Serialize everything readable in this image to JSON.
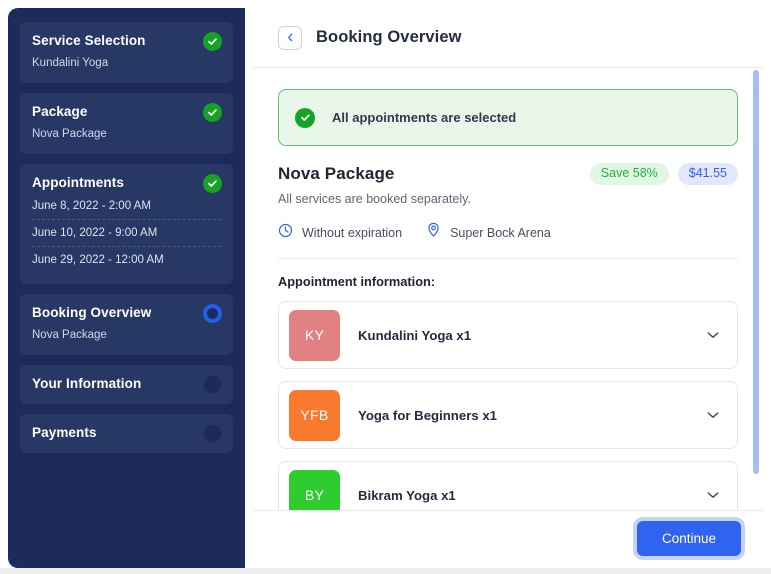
{
  "sidebar": {
    "items": [
      {
        "title": "Service Selection",
        "subtitle": "Kundalini Yoga",
        "status": "done",
        "status_icon": "check-circle-icon"
      },
      {
        "title": "Package",
        "subtitle": "Nova Package",
        "status": "done",
        "status_icon": "check-circle-icon"
      },
      {
        "title": "Appointments",
        "status": "done",
        "status_icon": "check-circle-icon",
        "dates": [
          "June 8, 2022 - 2:00 AM",
          "June 10, 2022 - 9:00 AM",
          "June 29, 2022 - 12:00 AM"
        ]
      },
      {
        "title": "Booking Overview",
        "subtitle": "Nova Package",
        "status": "active",
        "status_icon": "radio-ring-icon"
      },
      {
        "title": "Your Information",
        "status": "idle",
        "status_icon": "empty-circle-icon"
      },
      {
        "title": "Payments",
        "status": "idle",
        "status_icon": "empty-circle-icon"
      }
    ]
  },
  "header": {
    "back_icon": "chevron-left-icon",
    "title": "Booking Overview"
  },
  "alert": {
    "icon": "check-circle-icon",
    "message": "All appointments are selected"
  },
  "package": {
    "name": "Nova Package",
    "save_badge": "Save 58%",
    "price_badge": "$41.55",
    "description": "All services are booked separately.",
    "expiration_icon": "clock-icon",
    "expiration": "Without expiration",
    "location_icon": "map-pin-icon",
    "location": "Super Bock Arena"
  },
  "appointments_section": {
    "title": "Appointment information:",
    "items": [
      {
        "initials": "KY",
        "name": "Kundalini Yoga x1",
        "color": "#e28181",
        "expand_icon": "chevron-down-icon"
      },
      {
        "initials": "YFB",
        "name": "Yoga for Beginners x1",
        "color": "#f97a2e",
        "expand_icon": "chevron-down-icon"
      },
      {
        "initials": "BY",
        "name": "Bikram Yoga x1",
        "color": "#2ecc2e",
        "expand_icon": "chevron-down-icon"
      }
    ]
  },
  "footer": {
    "continue_label": "Continue"
  },
  "colors": {
    "sidebar_bg": "#1c2a5c",
    "sidebar_item_bg": "#283865",
    "accent_blue": "#2f63f0",
    "success_green": "#17a126",
    "alert_bg": "#e8f7ea",
    "alert_border": "#5bc473",
    "save_badge_bg": "#e2f6e4",
    "save_badge_text": "#22b33b",
    "price_badge_bg": "#e2e7fb",
    "price_badge_text": "#2f63f0",
    "scrollbar_thumb": "#a6bdf2"
  }
}
